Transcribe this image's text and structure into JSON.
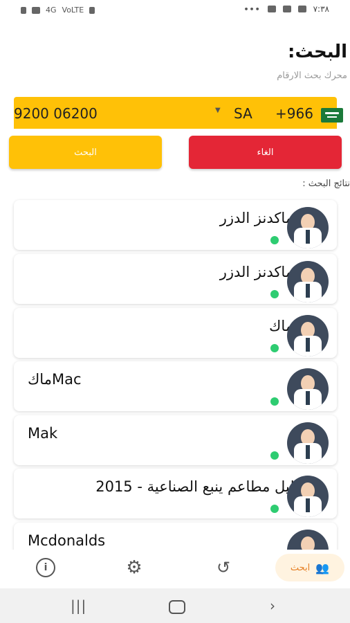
{
  "status_bar": {
    "time": "٧:٣٨",
    "net_label_1": "4G",
    "net_label_2": "VoLTE"
  },
  "header": {
    "title": "البحث:",
    "subtitle": "محرك بحث الارقام"
  },
  "phone_input": {
    "dial_code": "+966",
    "country": "SA",
    "number": "9200 06200"
  },
  "buttons": {
    "cancel_label": "الغاء",
    "search_label": "البحث"
  },
  "results_label": "نتائج البحث :",
  "results": [
    {
      "name": "ماكدنز الدزر",
      "online": true
    },
    {
      "name": "ماكدنز الدزر",
      "online": true
    },
    {
      "name": "ماك",
      "online": true
    },
    {
      "name": "ماكMac",
      "online": true
    },
    {
      "name": "Mak",
      "online": true
    },
    {
      "name": "دليل مطاعم ينبع الصناعية - 2015",
      "online": true
    },
    {
      "name": "Mcdonalds",
      "online": false
    }
  ],
  "bottom_nav": {
    "active_label": "ابحث",
    "items": [
      "info-icon",
      "settings-icon",
      "history-icon",
      "search-people-icon"
    ]
  },
  "colors": {
    "yellow": "#FFC107",
    "red": "#E42636",
    "online": "#2ecc71"
  }
}
